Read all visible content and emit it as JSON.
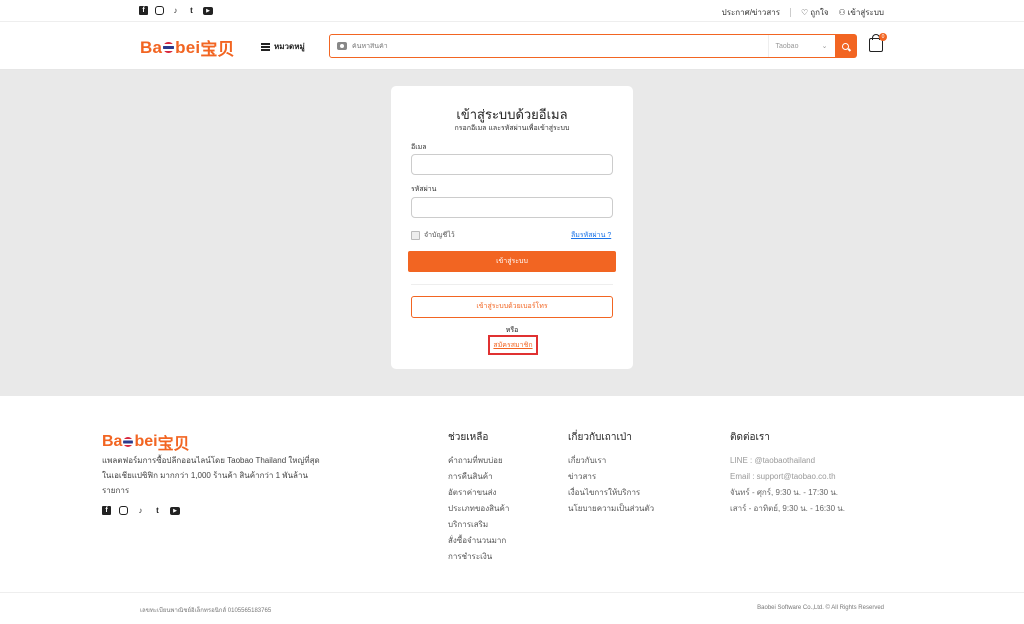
{
  "topbar": {
    "social": [
      {
        "icon": "facebook-icon",
        "glyph": "f"
      },
      {
        "icon": "instagram-icon",
        "glyph": "o"
      },
      {
        "icon": "tiktok-icon",
        "glyph": "♪"
      },
      {
        "icon": "twitter-icon",
        "glyph": "t"
      },
      {
        "icon": "youtube-icon",
        "glyph": "▶"
      }
    ],
    "news_label": "ประกาศ/ข่าวสาร",
    "wishlist_label": "ถูกใจ",
    "login_label": "เข้าสู่ระบบ"
  },
  "header": {
    "logo_left": "Ba",
    "logo_mid": "bei",
    "logo_cn": "宝贝",
    "menu_label": "หมวดหมู่",
    "search_placeholder": "ค้นหาสินค้า",
    "search_source": "Taobao",
    "cart_count": "0"
  },
  "login": {
    "title": "เข้าสู่ระบบด้วยอีเมล",
    "subtitle": "กรอกอีเมล และรหัสผ่านเพื่อเข้าสู่ระบบ",
    "email_label": "อีเมล",
    "email_value": "",
    "password_label": "รหัสผ่าน",
    "password_value": "",
    "remember_label": "จำบัญชีไว้",
    "forgot_label": "ลืมรหัสผ่าน ?",
    "login_button": "เข้าสู่ระบบ",
    "phone_button": "เข้าสู่ระบบด้วยเบอร์โทร",
    "or_label": "หรือ",
    "register_label": "สมัครสมาชิก"
  },
  "footer": {
    "description": "แพลตฟอร์มการซื้อปลีกออนไลน์โดย Taobao Thailand ใหญ่ที่สุดในเอเชียแปซิฟิก มากกว่า 1,000 ร้านค้า สินค้ากว่า 1 พันล้านรายการ",
    "help": {
      "title": "ช่วยเหลือ",
      "items": [
        "คำถามที่พบบ่อย",
        "การคืนสินค้า",
        "อัตราค่าขนส่ง",
        "ประเภทของสินค้า",
        "บริการเสริม",
        "สั่งซื้อจำนวนมาก",
        "การชำระเงิน"
      ]
    },
    "about": {
      "title": "เกี่ยวกับเถาเป่า",
      "items": [
        "เกี่ยวกับเรา",
        "ข่าวสาร",
        "เงื่อนไขการให้บริการ",
        "นโยบายความเป็นส่วนตัว"
      ]
    },
    "contact": {
      "title": "ติดต่อเรา",
      "items": [
        "LINE : @taobaothailand",
        "Email : support@taobao.co.th",
        "จันทร์ - ศุกร์, 9:30 น. - 17:30 น.",
        "เสาร์ - อาทิตย์, 9:30 น. - 16:30 น."
      ]
    },
    "registration": "เลขทะเบียนพาณิชย์อิเล็กทรอนิกส์ 0105565183765",
    "copyright": "Baobei Software Co.,Ltd. © All Rights Reserved"
  }
}
